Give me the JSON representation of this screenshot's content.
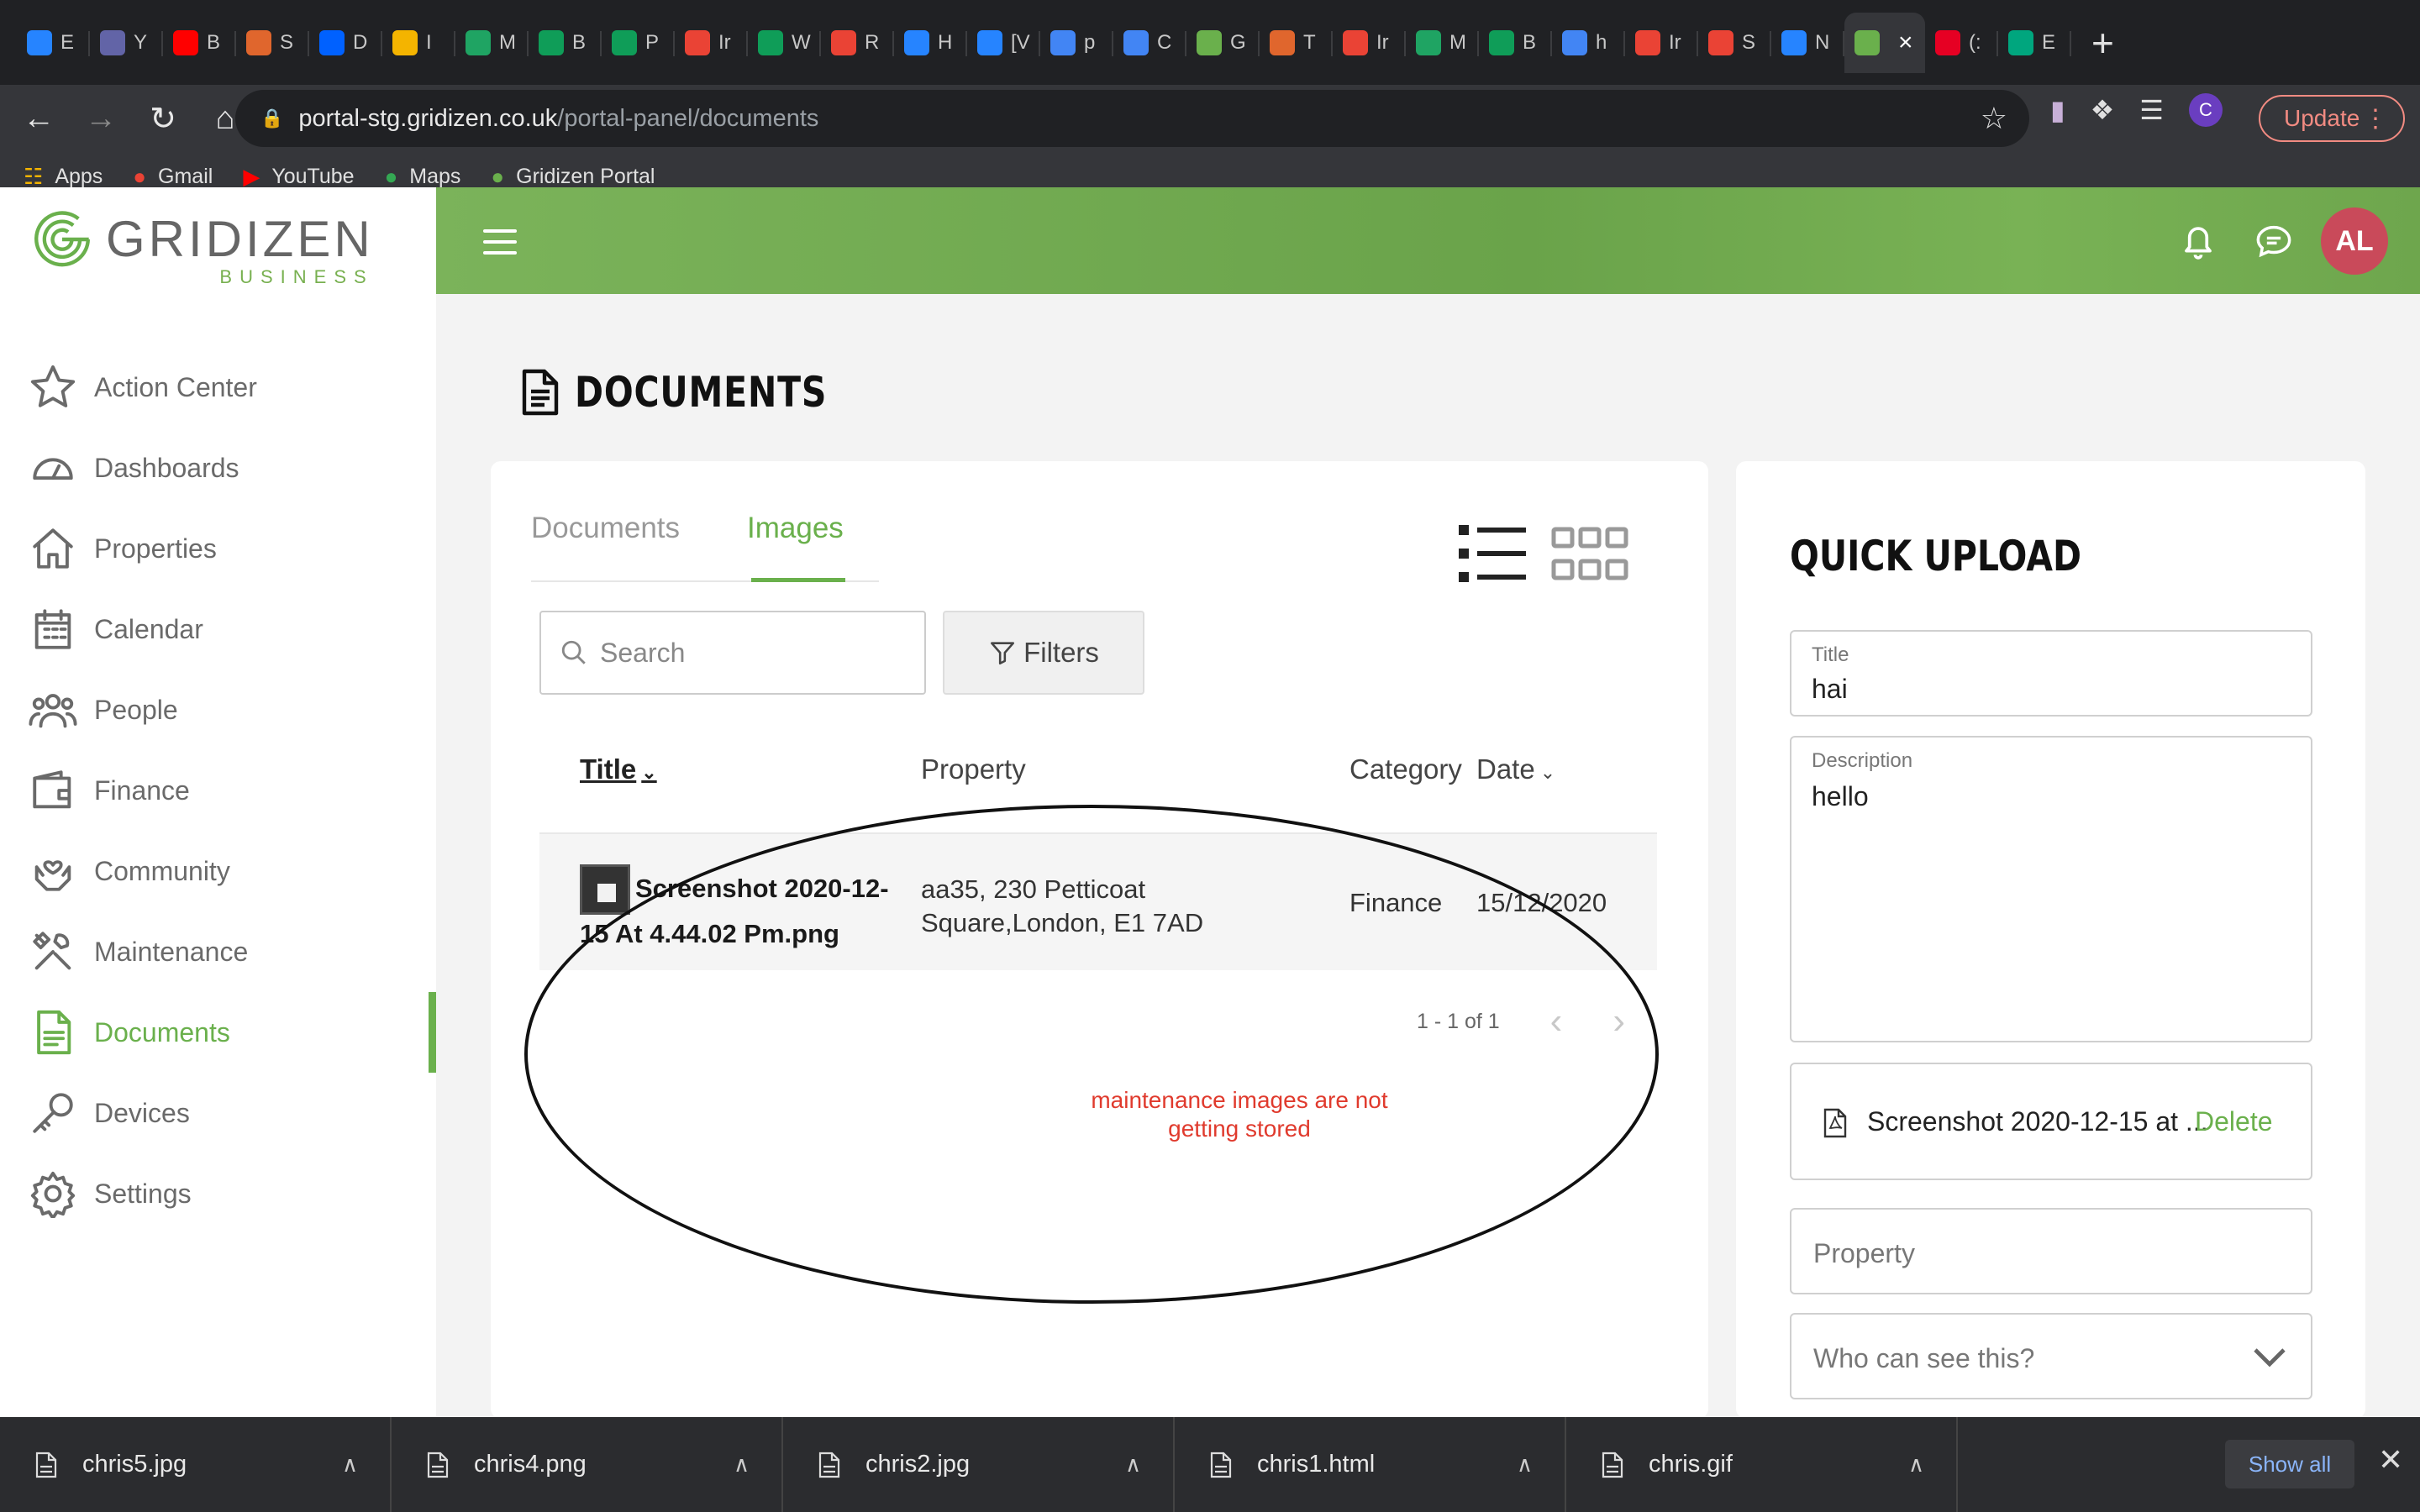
{
  "browser": {
    "tabs": [
      {
        "label": "E",
        "icon": "jira-icon",
        "color": "#2684ff"
      },
      {
        "label": "Y",
        "icon": "yammer-icon",
        "color": "#6264a7"
      },
      {
        "label": "B",
        "icon": "youtube-icon",
        "color": "#ff0000"
      },
      {
        "label": "S",
        "icon": "trello-icon",
        "color": "#e0662d"
      },
      {
        "label": "D",
        "icon": "dropbox-icon",
        "color": "#0061ff"
      },
      {
        "label": "I",
        "icon": "doc-icon",
        "color": "#f4b400"
      },
      {
        "label": "M",
        "icon": "drive-icon",
        "color": "#1fa463"
      },
      {
        "label": "B",
        "icon": "sheets-icon",
        "color": "#0f9d58"
      },
      {
        "label": "P",
        "icon": "sheets-icon",
        "color": "#0f9d58"
      },
      {
        "label": "Ir",
        "icon": "gmail-icon",
        "color": "#ea4335"
      },
      {
        "label": "W",
        "icon": "sheets-icon",
        "color": "#0f9d58"
      },
      {
        "label": "R",
        "icon": "gmail-icon",
        "color": "#ea4335"
      },
      {
        "label": "H",
        "icon": "confluence-icon",
        "color": "#2684ff"
      },
      {
        "label": "[V",
        "icon": "jira-icon",
        "color": "#2684ff"
      },
      {
        "label": "p",
        "icon": "google-icon",
        "color": "#4285f4"
      },
      {
        "label": "C",
        "icon": "calendar-icon",
        "color": "#4285f4"
      },
      {
        "label": "G",
        "icon": "gridizen-icon",
        "color": "#6ab04c"
      },
      {
        "label": "T",
        "icon": "trello-icon",
        "color": "#e0662d"
      },
      {
        "label": "Ir",
        "icon": "gmail-icon",
        "color": "#ea4335"
      },
      {
        "label": "M",
        "icon": "drive-icon",
        "color": "#1fa463"
      },
      {
        "label": "B",
        "icon": "sheets-icon",
        "color": "#0f9d58"
      },
      {
        "label": "h",
        "icon": "google-icon",
        "color": "#4285f4"
      },
      {
        "label": "Ir",
        "icon": "gmail-icon",
        "color": "#ea4335"
      },
      {
        "label": "S",
        "icon": "gmail-icon",
        "color": "#ea4335"
      },
      {
        "label": "N",
        "icon": "confluence-icon",
        "color": "#2684ff"
      },
      {
        "label": "",
        "icon": "gridizen-icon",
        "color": "#6ab04c",
        "active": true
      },
      {
        "label": "(:",
        "icon": "pinterest-icon",
        "color": "#e60023"
      },
      {
        "label": "E",
        "icon": "edit-icon",
        "color": "#00a67e"
      }
    ],
    "url_host": "portal-stg.gridizen.co.uk",
    "url_path": "/portal-panel/documents",
    "profile_initial": "C",
    "update_label": "Update",
    "bookmarks": [
      {
        "label": "Apps",
        "icon": "apps-grid-icon"
      },
      {
        "label": "Gmail",
        "icon": "gmail-icon"
      },
      {
        "label": "YouTube",
        "icon": "youtube-icon"
      },
      {
        "label": "Maps",
        "icon": "maps-icon"
      },
      {
        "label": "Gridizen Portal",
        "icon": "gridizen-icon"
      }
    ]
  },
  "brand": {
    "name": "GRIDIZEN",
    "sub": "BUSINESS",
    "accent": "#6ab04c"
  },
  "sidebar": {
    "items": [
      {
        "label": "Action Center",
        "icon": "star-icon",
        "active": false
      },
      {
        "label": "Dashboards",
        "icon": "gauge-icon",
        "active": false
      },
      {
        "label": "Properties",
        "icon": "house-icon",
        "active": false
      },
      {
        "label": "Calendar",
        "icon": "calendar-icon",
        "active": false
      },
      {
        "label": "People",
        "icon": "people-icon",
        "active": false
      },
      {
        "label": "Finance",
        "icon": "wallet-icon",
        "active": false
      },
      {
        "label": "Community",
        "icon": "heart-hands-icon",
        "active": false
      },
      {
        "label": "Maintenance",
        "icon": "tools-icon",
        "active": false
      },
      {
        "label": "Documents",
        "icon": "document-icon",
        "active": true
      },
      {
        "label": "Devices",
        "icon": "key-icon",
        "active": false
      },
      {
        "label": "Settings",
        "icon": "gear-icon",
        "active": false
      }
    ]
  },
  "header": {
    "avatar_initials": "AL"
  },
  "page": {
    "title": "DOCUMENTS"
  },
  "documents": {
    "tabs": [
      {
        "label": "Documents",
        "selected": false
      },
      {
        "label": "Images",
        "selected": true
      }
    ],
    "search_placeholder": "Search",
    "filters_label": "Filters",
    "columns": {
      "title": "Title",
      "property": "Property",
      "category": "Category",
      "date": "Date"
    },
    "rows": [
      {
        "title": "Screenshot 2020-12-15 At 4.44.02 Pm.png",
        "property": "aa35, 230 Petticoat Square,London, E1 7AD",
        "category": "Finance",
        "date": "15/12/2020"
      }
    ],
    "pagination": "1 - 1 of 1"
  },
  "annotation": {
    "text": "maintenance images are not getting stored",
    "color": "#e03a2d"
  },
  "quick_upload": {
    "title": "QUICK UPLOAD",
    "title_label": "Title",
    "title_value": "hai",
    "description_label": "Description",
    "description_value": "hello",
    "file_name": "Screenshot 2020-12-15 at ...",
    "delete_label": "Delete",
    "property_placeholder": "Property",
    "visibility_placeholder": "Who can see this?"
  },
  "downloads": {
    "items": [
      "chris5.jpg",
      "chris4.png",
      "chris2.jpg",
      "chris1.html",
      "chris.gif"
    ],
    "show_all": "Show all"
  }
}
